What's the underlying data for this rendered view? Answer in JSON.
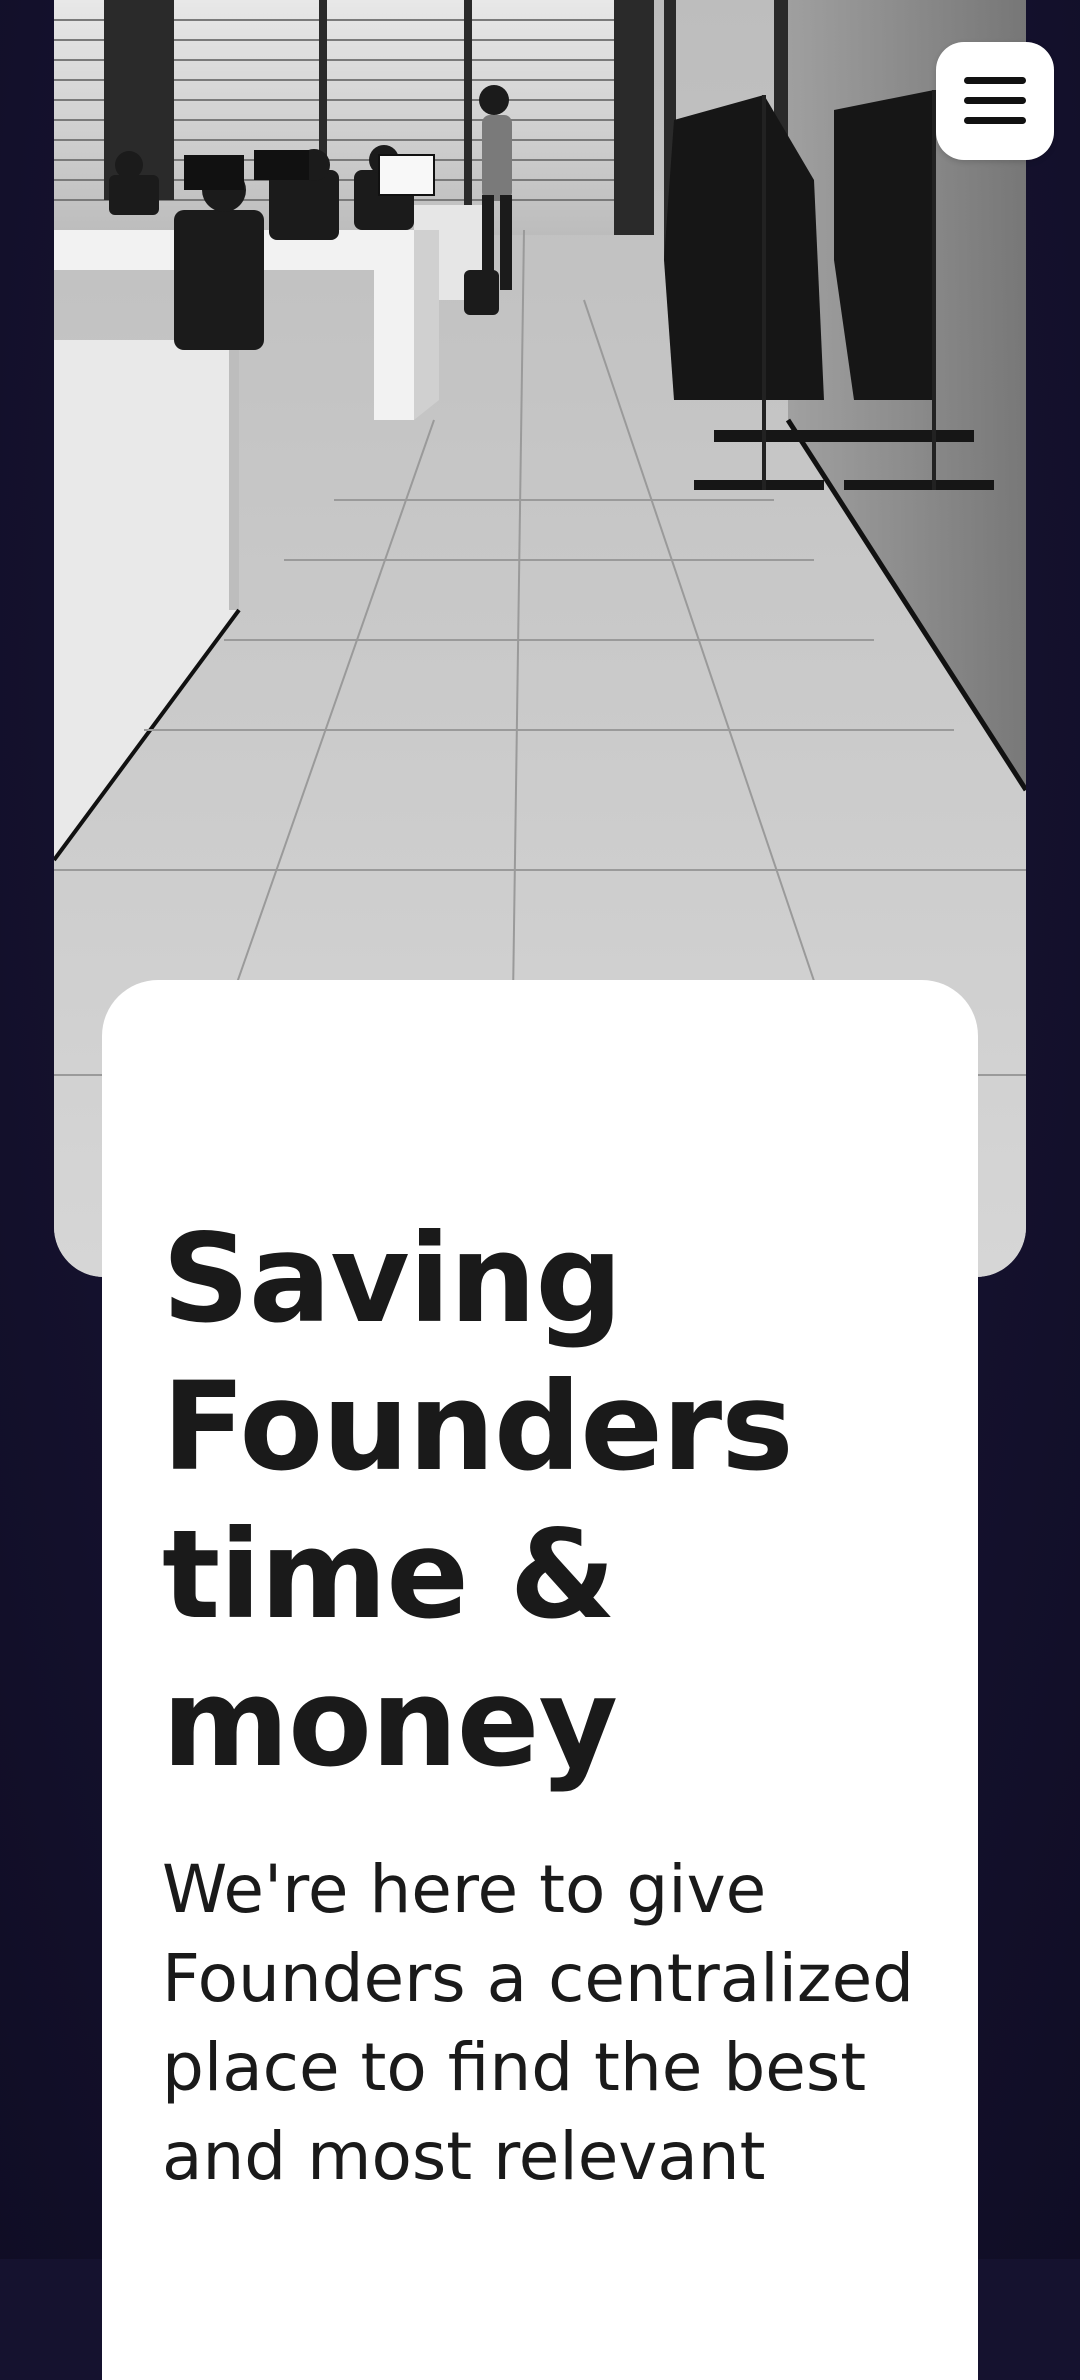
{
  "hero": {
    "image_subject": "black-and-white open office interior with desks, people working and clothes racks"
  },
  "menu": {
    "icon": "hamburger-menu-icon"
  },
  "main": {
    "headline": "Saving Founders time & money",
    "subtext": "We're here to give Founders a centralized place to find the best and most relevant"
  },
  "colors": {
    "page_background": "#15122f",
    "card_background": "#ffffff",
    "text": "#1a1a1a"
  }
}
